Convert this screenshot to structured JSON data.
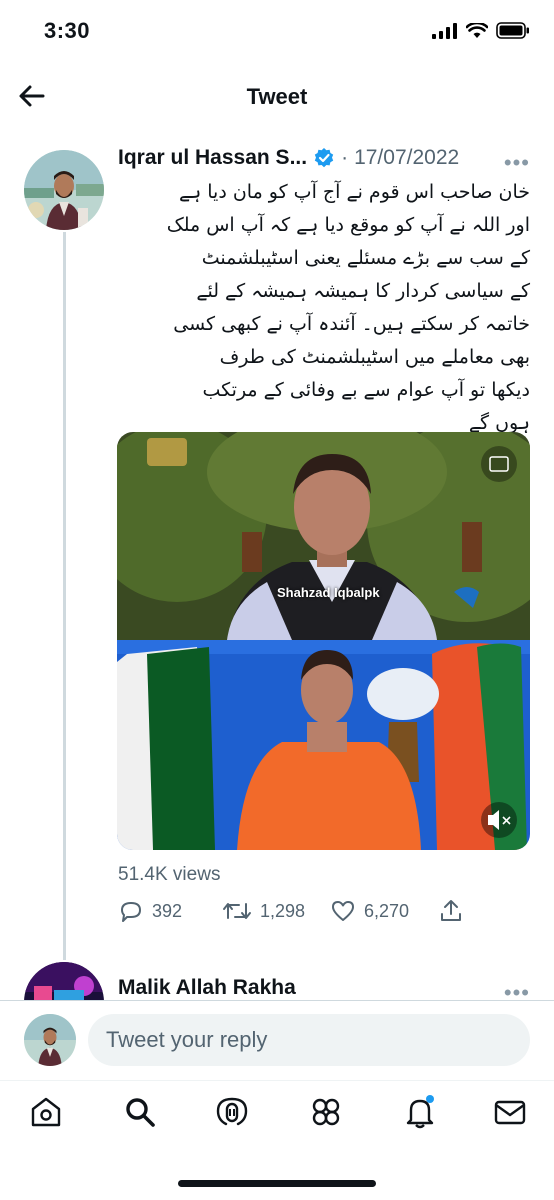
{
  "status_bar": {
    "time": "3:30"
  },
  "header": {
    "title": "Tweet"
  },
  "tweet": {
    "author_name": "Iqrar ul Hassan S...",
    "separator": "·",
    "date": "17/07/2022",
    "text": "خان صاحب اس قوم نے آج آپ کو مان دیا ہے\nاور اللہ نے آپ کو موقع دیا ہے کہ آپ اس ملک\nکے سب سے بڑے مسئلے یعنی اسٹیبلشمنٹ\nکے سیاسی کردار کا ہمیشہ ہمیشہ کے لئے\nخاتمہ کر سکتے ہیں۔ آئندہ آپ نے کبھی کسی\nبھی معاملے میں اسٹیبلشمنٹ کی طرف\nدیکھا تو آپ عوام سے بے وفائی کے مرتکب\nہوں گے",
    "media_caption": "Shahzad Iqbalpk",
    "views": "51.4K views",
    "replies": "392",
    "retweets": "1,298",
    "likes": "6,270"
  },
  "next_reply": {
    "author_name": "Malik Allah Rakha"
  },
  "composer": {
    "placeholder": "Tweet your reply"
  },
  "colors": {
    "accent": "#1d9bf0",
    "text": "#0f1419",
    "secondary": "#536471"
  },
  "nav": [
    "home-icon",
    "search-icon",
    "spaces-icon",
    "communities-icon",
    "notifications-icon",
    "messages-icon"
  ]
}
